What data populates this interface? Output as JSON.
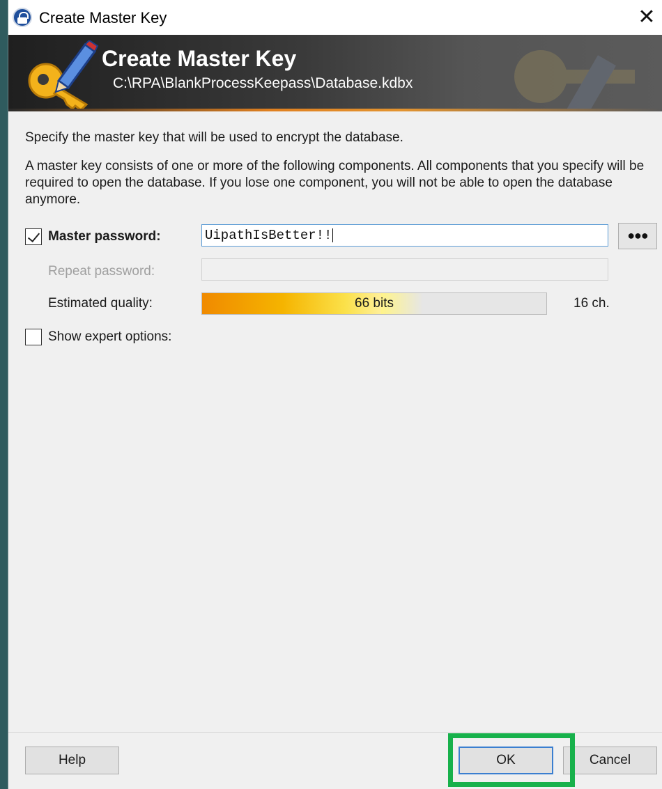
{
  "window": {
    "title": "Create Master Key",
    "close_glyph": "✕"
  },
  "banner": {
    "title": "Create Master Key",
    "path": "C:\\RPA\\BlankProcessKeepass\\Database.kdbx",
    "icon": "key-pencil-icon"
  },
  "intro": {
    "line1": "Specify the master key that will be used to encrypt the database.",
    "line2": "A master key consists of one or more of the following components. All components that you specify will be required to open the database. If you lose one component, you will not be able to open the database anymore."
  },
  "form": {
    "master_password_label": "Master password:",
    "master_password_checked": true,
    "master_password_value": "UipathIsBetter!!",
    "toggle_button_label": "●●●",
    "repeat_password_label": "Repeat password:",
    "repeat_password_value": "",
    "quality_label": "Estimated quality:",
    "quality_text": "66 bits",
    "quality_fraction": 0.52,
    "char_count": "16 ch.",
    "expert_options_label": "Show expert options:",
    "expert_options_checked": false
  },
  "footer": {
    "help_label": "Help",
    "ok_label": "OK",
    "cancel_label": "Cancel"
  },
  "colors": {
    "highlight": "#17b14b",
    "banner_accent": "#e08020"
  }
}
